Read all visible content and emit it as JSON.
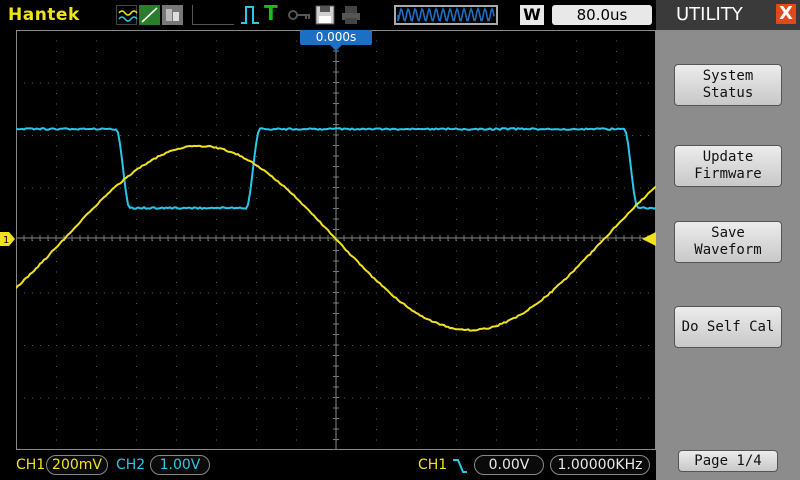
{
  "brand": "Hantek",
  "trigger_mode_letter": "T",
  "window_indicator": "W",
  "timebase": "80.0us",
  "trigger_position": "0.000s",
  "channels": {
    "ch1": {
      "label": "CH1",
      "scale": "200mV",
      "color": "#f2e21b"
    },
    "ch2": {
      "label": "CH2",
      "scale": "1.00V",
      "color": "#28c8e8"
    }
  },
  "trigger": {
    "source": "CH1",
    "level": "0.00V",
    "frequency": "1.00000KHz",
    "slope": "falling-edge-icon"
  },
  "menu": {
    "title": "UTILITY",
    "close_glyph": "X",
    "buttons": [
      {
        "line1": "System",
        "line2": "Status"
      },
      {
        "line1": "Update",
        "line2": "Firmware"
      },
      {
        "line1": "Save",
        "line2": "Waveform"
      },
      {
        "line1": "Do Self Cal",
        "line2": ""
      }
    ],
    "page": "Page 1/4"
  },
  "colors": {
    "accent_blue": "#1d6fc4",
    "menu_bg": "#8c8c8c",
    "close_red": "#e04a1a",
    "trigger_green": "#18c010"
  }
}
